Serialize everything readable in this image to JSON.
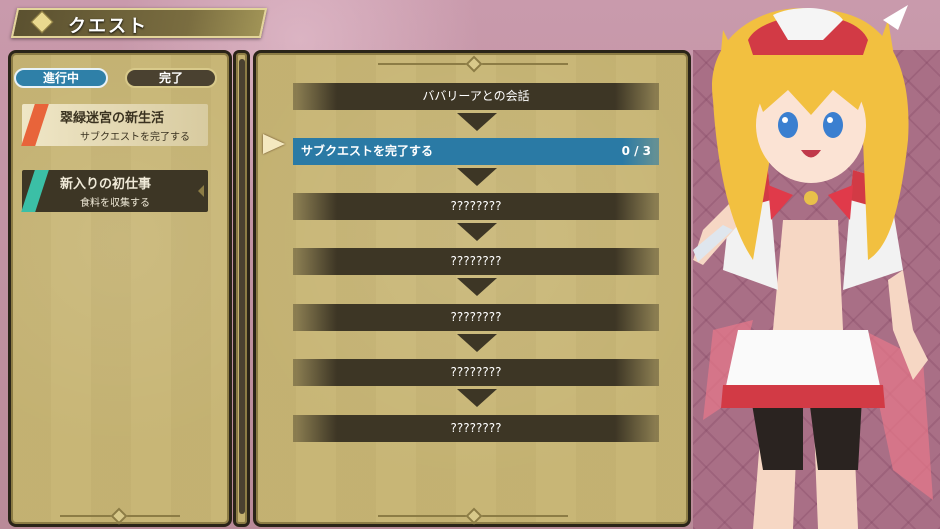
{
  "header": {
    "title": "クエスト"
  },
  "tabs": [
    {
      "label": "進行中",
      "active": true
    },
    {
      "label": "完了",
      "active": false
    }
  ],
  "quests": [
    {
      "title": "翠緑迷宮の新生活",
      "subtitle": "サブクエストを完了する",
      "accent": "#e8643a"
    },
    {
      "title": "新入りの初仕事",
      "subtitle": "食料を収集する",
      "accent": "#3bbfa6"
    }
  ],
  "steps": [
    {
      "label": "ババリーアとの会話",
      "count": ""
    },
    {
      "label": "サブクエストを完了する",
      "count": "0 / 3",
      "active": true
    },
    {
      "label": "????????",
      "count": ""
    },
    {
      "label": "????????",
      "count": ""
    },
    {
      "label": "????????",
      "count": ""
    },
    {
      "label": "????????",
      "count": ""
    },
    {
      "label": "????????",
      "count": ""
    }
  ],
  "colors": {
    "panel": "#c8b676",
    "active_blue": "#2a7aa5",
    "dark_bar": "#3d3625",
    "accent_gold": "#e3d59a"
  }
}
